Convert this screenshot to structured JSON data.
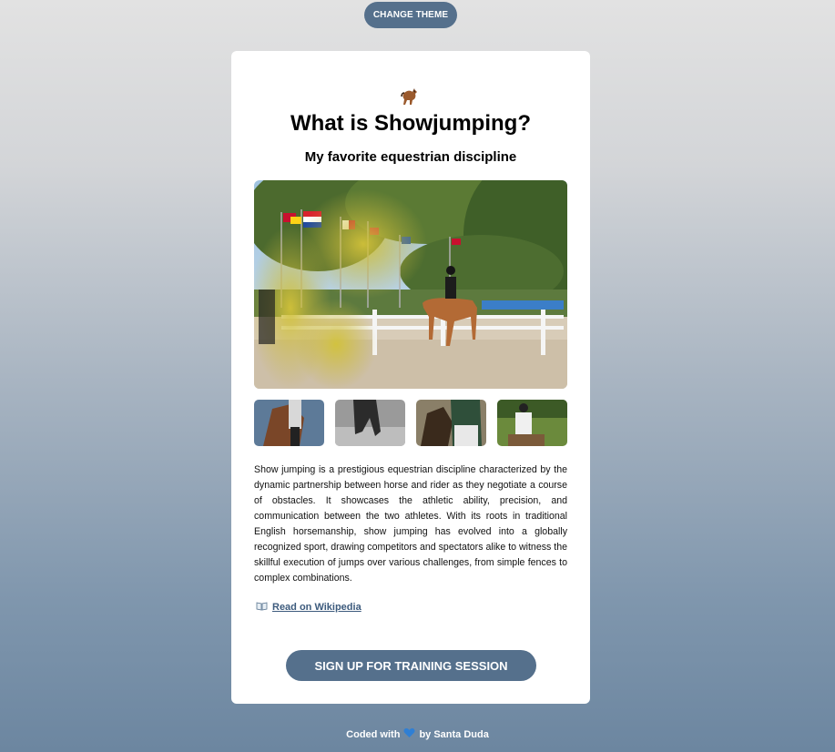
{
  "header": {
    "theme_button_label": "CHANGE THEME"
  },
  "card": {
    "icon": "horse-icon",
    "title": "What is Showjumping?",
    "subtitle": "My favorite equestrian discipline",
    "hero_image": "show-jumping-arena-photo",
    "thumbnails": [
      "rider-closeup-photo",
      "horse-hooves-bw-photo",
      "rider-dressage-photo",
      "rider-white-outfit-photo"
    ],
    "description": "Show jumping is a prestigious equestrian discipline characterized by the dynamic partnership between horse and rider as they negotiate a course of obstacles. It showcases the athletic ability, precision, and communication between the two athletes. With its roots in traditional English horsemanship, show jumping has evolved into a globally recognized sport, drawing competitors and spectators alike to witness the skillful execution of jumps over various challenges, from simple fences to complex combinations.",
    "wiki_icon": "book-icon",
    "wiki_link": "Read on Wikipedia",
    "signup_button": "SIGN UP FOR TRAINING SESSION"
  },
  "footer": {
    "prefix": "Coded with",
    "heart_icon": "heart-icon",
    "suffix": "by Santa Duda"
  },
  "colors": {
    "accent": "#55708c",
    "link": "#3d5b7d"
  }
}
